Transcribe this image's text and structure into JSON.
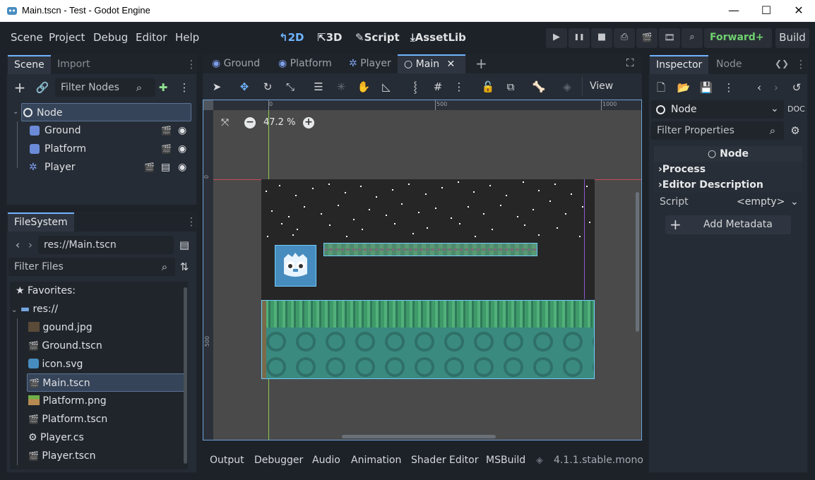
{
  "window": {
    "title": "Main.tscn - Test - Godot Engine",
    "controls": [
      "—",
      "☐",
      "✕"
    ]
  },
  "menu": [
    "Scene",
    "Project",
    "Debug",
    "Editor",
    "Help"
  ],
  "workspaces": [
    {
      "label": "2D",
      "icon": "↰"
    },
    {
      "label": "3D",
      "icon": "⇱"
    },
    {
      "label": "Script",
      "icon": "✎"
    },
    {
      "label": "AssetLib",
      "icon": "⤓"
    }
  ],
  "run_buttons": [
    "▶",
    "❚❚",
    "■",
    "⎙",
    "🎬",
    "🎞",
    "⌕"
  ],
  "renderer": "Forward+ ⌄",
  "build": "Build",
  "scene_panel": {
    "tabs": [
      "Scene",
      "Import"
    ],
    "filter_placeholder": "Filter Nodes",
    "nodes": [
      {
        "name": "Node"
      },
      {
        "name": "Ground"
      },
      {
        "name": "Platform"
      },
      {
        "name": "Player"
      }
    ]
  },
  "filesystem": {
    "tab": "FileSystem",
    "path": "res://Main.tscn",
    "filter_placeholder": "Filter Files",
    "favorites": "Favorites:",
    "root": "res://",
    "files": [
      {
        "name": "gound.jpg",
        "icon": "image-icon"
      },
      {
        "name": "Ground.tscn",
        "icon": "scene-icon"
      },
      {
        "name": "icon.svg",
        "icon": "godot-icon"
      },
      {
        "name": "Main.tscn",
        "icon": "scene-icon"
      },
      {
        "name": "Platform.png",
        "icon": "image-icon"
      },
      {
        "name": "Platform.tscn",
        "icon": "scene-icon"
      },
      {
        "name": "Player.cs",
        "icon": "script-icon"
      },
      {
        "name": "Player.tscn",
        "icon": "scene-icon"
      }
    ]
  },
  "scene_tabs": [
    {
      "label": "Ground"
    },
    {
      "label": "Platform"
    },
    {
      "label": "Player"
    },
    {
      "label": "Main"
    }
  ],
  "toolbar": {
    "view": "View"
  },
  "viewport": {
    "zoom": "47.2 %",
    "ruler_h": [
      "0",
      "500",
      "1000"
    ],
    "ruler_v": [
      "0",
      "500"
    ]
  },
  "bottom_tabs": [
    "Output",
    "Debugger",
    "Audio",
    "Animation",
    "Shader Editor",
    "MSBuild"
  ],
  "version": "4.1.1.stable.mono",
  "inspector": {
    "tabs": [
      "Inspector",
      "Node"
    ],
    "node_type": "Node",
    "filter_placeholder": "Filter Properties",
    "class_header": "Node",
    "sections": [
      "Process",
      "Editor Description"
    ],
    "script_label": "Script",
    "script_value": "<empty>",
    "add_metadata": "Add Metadata"
  },
  "colors": {
    "accent": "#70b4ff",
    "renderer": "#6fd06f",
    "panel": "#262c35",
    "background": "#1d2229"
  }
}
